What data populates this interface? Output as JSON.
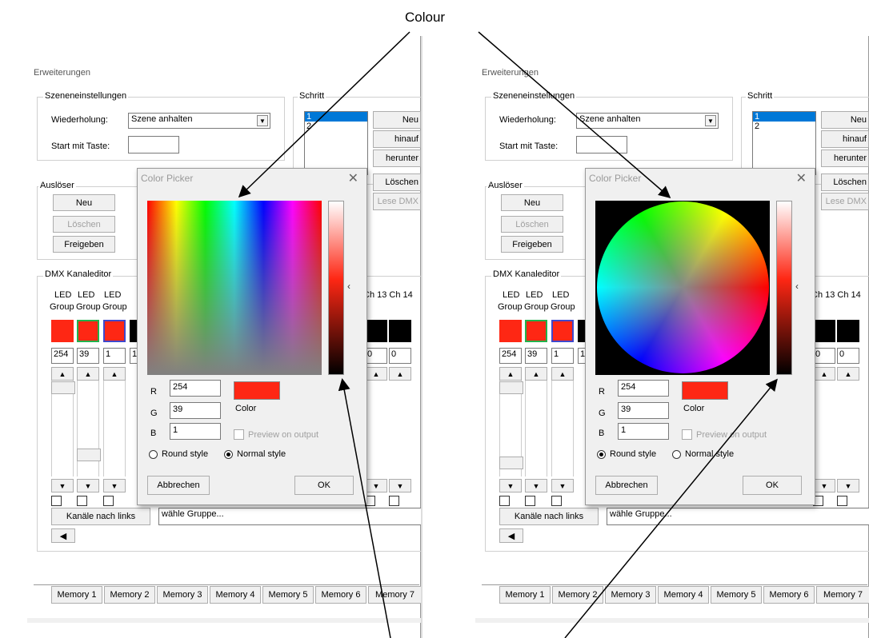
{
  "annotation": {
    "label": "Colour"
  },
  "window": {
    "extensions_label": "Erweiterungen",
    "scene_settings": {
      "title": "Szeneneinstellungen",
      "repeat_label": "Wiederholung:",
      "repeat_value": "Szene anhalten",
      "start_key_label": "Start mit Taste:",
      "start_key_value": ""
    },
    "step": {
      "title": "Schritt",
      "items": [
        "1",
        "2"
      ],
      "buttons": [
        "Neu",
        "hinauf",
        "herunter",
        "Löschen",
        "Lese DMX"
      ]
    },
    "trigger": {
      "title": "Auslöser",
      "new": "Neu",
      "delete": "Löschen",
      "release": "Freigeben"
    },
    "dmx": {
      "title": "DMX Kanaleditor",
      "channel_header_top": "LED",
      "channel_header_bottom": "Group",
      "extra_headers": "Ch 13 Ch 14",
      "values": [
        "254",
        "39",
        "1",
        "1",
        "0",
        "0"
      ],
      "colors": {
        "ch1": "#fe2714",
        "ch2": "#fe2714",
        "ch3": "#fe2714",
        "black": "#000000",
        "green_border": "#22b14c",
        "blue_border": "#3f48cc"
      }
    },
    "bottom": {
      "channels_left": "Kanäle nach links",
      "group_select": "wähle Gruppe...",
      "memories": [
        "Memory 1",
        "Memory 2",
        "Memory 3",
        "Memory 4",
        "Memory 5",
        "Memory 6",
        "Memory 7"
      ]
    }
  },
  "color_picker": {
    "title": "Color Picker",
    "r_label": "R",
    "g_label": "G",
    "b_label": "B",
    "r_value": "254",
    "g_value": "39",
    "b_value": "1",
    "color_label": "Color",
    "preview_label": "Preview on output",
    "round_style": "Round style",
    "normal_style": "Normal style",
    "cancel": "Abbrechen",
    "ok": "OK",
    "swatch_color": "#fe2714",
    "left_selected_style": "normal",
    "right_selected_style": "round"
  }
}
